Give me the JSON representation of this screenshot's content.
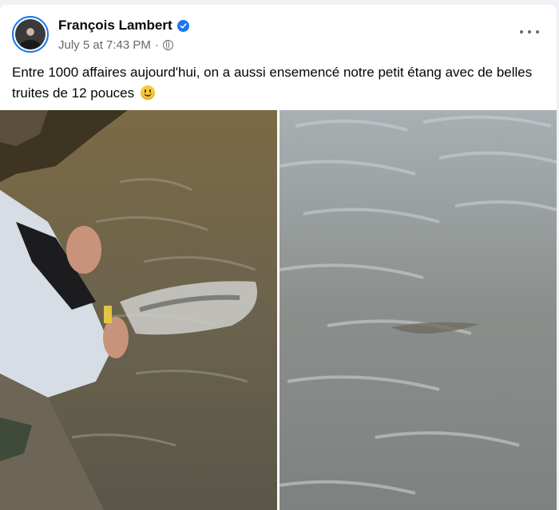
{
  "post": {
    "author": "François Lambert",
    "timestamp": "July 5 at 7:43 PM",
    "separator": "·",
    "text": "Entre 1000 affaires aujourd'hui, on a aussi ensemencé notre petit étang avec de belles truites de 12 pouces",
    "emoji": "slightly-smiling-face",
    "privacy_icon": "globe-icon",
    "verified_icon": "verified-badge-icon",
    "menu_icon": "more-options-icon"
  },
  "photos": [
    {
      "description": "hand releasing trout from plastic bag into pond"
    },
    {
      "description": "trout swimming in pond water"
    }
  ],
  "colors": {
    "accent": "#1877f2",
    "text_primary": "#050505",
    "text_secondary": "#65676b",
    "background": "#f0f2f5"
  }
}
